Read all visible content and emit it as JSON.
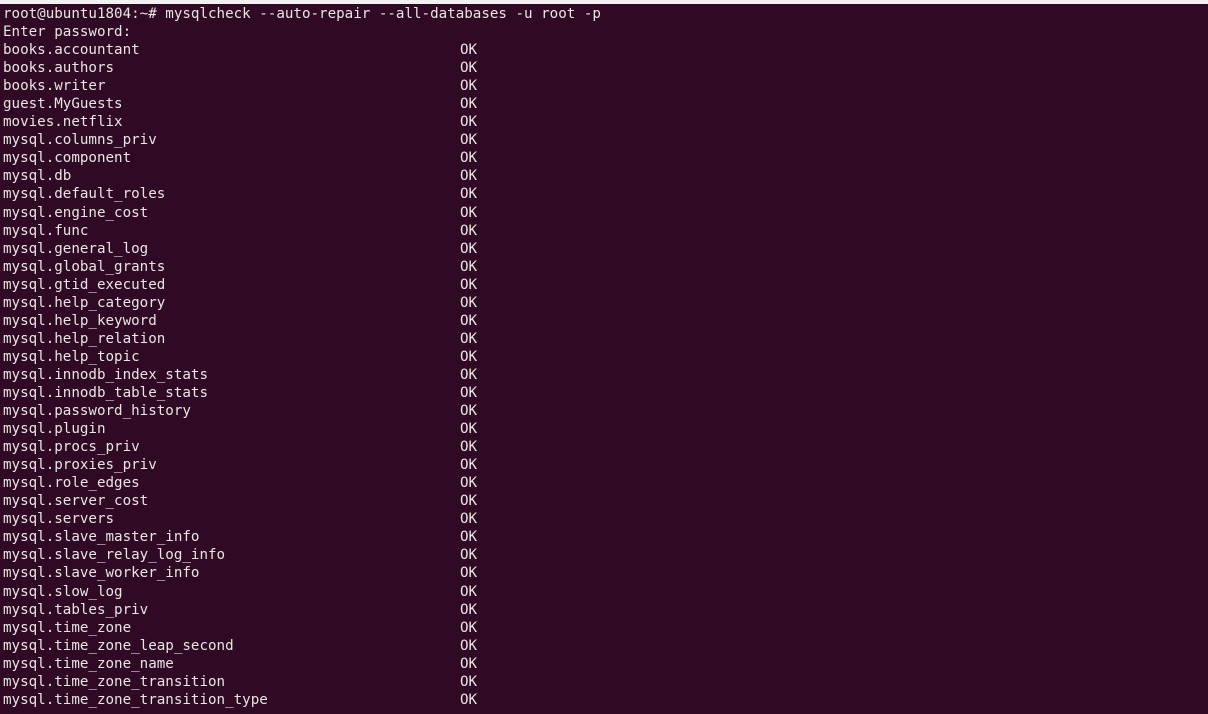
{
  "terminal": {
    "background_color": "#300a24",
    "text_color": "#e8e6e3",
    "prompt": "root@ubuntu1804:~#",
    "command": " mysqlcheck --auto-repair --all-databases -u root -p",
    "password_prompt": "Enter password:",
    "status_column_label": "OK",
    "results": [
      {
        "name": "books.accountant",
        "status": "OK"
      },
      {
        "name": "books.authors",
        "status": "OK"
      },
      {
        "name": "books.writer",
        "status": "OK"
      },
      {
        "name": "guest.MyGuests",
        "status": "OK"
      },
      {
        "name": "movies.netflix",
        "status": "OK"
      },
      {
        "name": "mysql.columns_priv",
        "status": "OK"
      },
      {
        "name": "mysql.component",
        "status": "OK"
      },
      {
        "name": "mysql.db",
        "status": "OK"
      },
      {
        "name": "mysql.default_roles",
        "status": "OK"
      },
      {
        "name": "mysql.engine_cost",
        "status": "OK"
      },
      {
        "name": "mysql.func",
        "status": "OK"
      },
      {
        "name": "mysql.general_log",
        "status": "OK"
      },
      {
        "name": "mysql.global_grants",
        "status": "OK"
      },
      {
        "name": "mysql.gtid_executed",
        "status": "OK"
      },
      {
        "name": "mysql.help_category",
        "status": "OK"
      },
      {
        "name": "mysql.help_keyword",
        "status": "OK"
      },
      {
        "name": "mysql.help_relation",
        "status": "OK"
      },
      {
        "name": "mysql.help_topic",
        "status": "OK"
      },
      {
        "name": "mysql.innodb_index_stats",
        "status": "OK"
      },
      {
        "name": "mysql.innodb_table_stats",
        "status": "OK"
      },
      {
        "name": "mysql.password_history",
        "status": "OK"
      },
      {
        "name": "mysql.plugin",
        "status": "OK"
      },
      {
        "name": "mysql.procs_priv",
        "status": "OK"
      },
      {
        "name": "mysql.proxies_priv",
        "status": "OK"
      },
      {
        "name": "mysql.role_edges",
        "status": "OK"
      },
      {
        "name": "mysql.server_cost",
        "status": "OK"
      },
      {
        "name": "mysql.servers",
        "status": "OK"
      },
      {
        "name": "mysql.slave_master_info",
        "status": "OK"
      },
      {
        "name": "mysql.slave_relay_log_info",
        "status": "OK"
      },
      {
        "name": "mysql.slave_worker_info",
        "status": "OK"
      },
      {
        "name": "mysql.slow_log",
        "status": "OK"
      },
      {
        "name": "mysql.tables_priv",
        "status": "OK"
      },
      {
        "name": "mysql.time_zone",
        "status": "OK"
      },
      {
        "name": "mysql.time_zone_leap_second",
        "status": "OK"
      },
      {
        "name": "mysql.time_zone_name",
        "status": "OK"
      },
      {
        "name": "mysql.time_zone_transition",
        "status": "OK"
      },
      {
        "name": "mysql.time_zone_transition_type",
        "status": "OK"
      }
    ]
  }
}
